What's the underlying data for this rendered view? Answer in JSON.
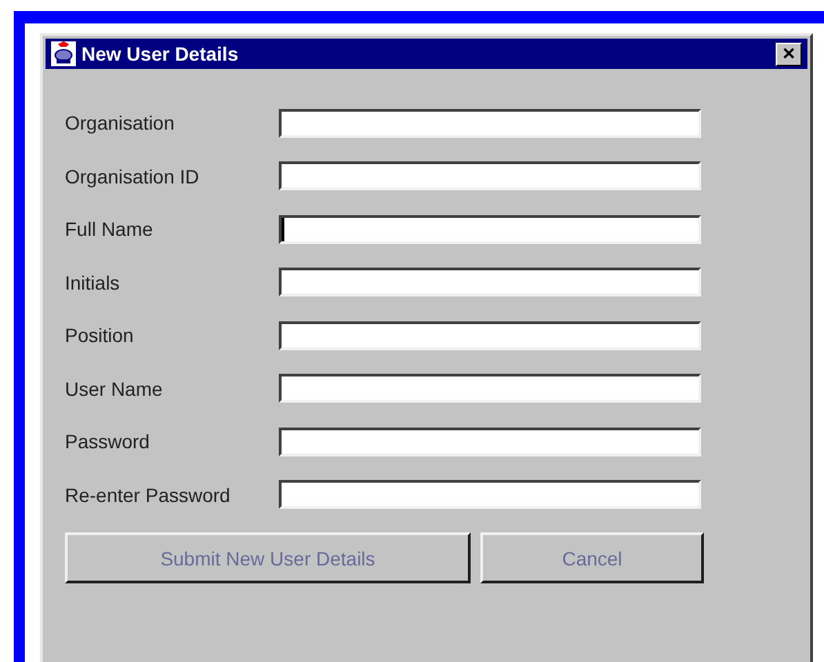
{
  "window": {
    "title": "New User Details",
    "close": "✕"
  },
  "fields": [
    {
      "label": "Organisation",
      "focused": false
    },
    {
      "label": "Organisation ID",
      "focused": false
    },
    {
      "label": "Full Name",
      "focused": true
    },
    {
      "label": "Initials",
      "focused": false
    },
    {
      "label": "Position",
      "focused": false
    },
    {
      "label": "User Name",
      "focused": false
    },
    {
      "label": "Password",
      "focused": false
    },
    {
      "label": "Re-enter Password",
      "focused": false
    }
  ],
  "buttons": [
    {
      "label": "Submit New User Details"
    },
    {
      "label": "Cancel"
    }
  ]
}
